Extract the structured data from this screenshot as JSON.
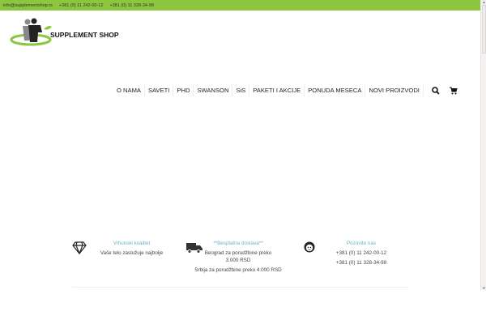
{
  "topbar": {
    "email": "info@supplementshop.rs",
    "phone1": "+381 (0) 11 242-00-12",
    "phone2": "+381 (0) 11 328-34-98"
  },
  "logo": {
    "text": "SUPPLEMENT SHOP"
  },
  "nav": {
    "items": [
      "O NAMA",
      "SAVETI",
      "PHD",
      "SWANSON",
      "SiS",
      "PAKETI I AKCIJE",
      "PONUDA MESECA",
      "NOVI PROIZVODI"
    ]
  },
  "features": [
    {
      "title": "Vrhunski kvalitet",
      "lines": [
        "Vaše telo zaslužuje najbolje"
      ]
    },
    {
      "title": "**Besplatna dostava**",
      "lines": [
        "Beograd za porudžbine preko 3.000 RSD",
        "Srbija za porudžbine preko 4.000 RSD"
      ]
    },
    {
      "title": "Pozovite nas",
      "lines": [
        "+381 (0) 11 242-00-12",
        "+381 (0) 11 328-34-98"
      ]
    }
  ],
  "colors": {
    "brand": "#8cc63f",
    "accent": "#6ab0c8"
  }
}
